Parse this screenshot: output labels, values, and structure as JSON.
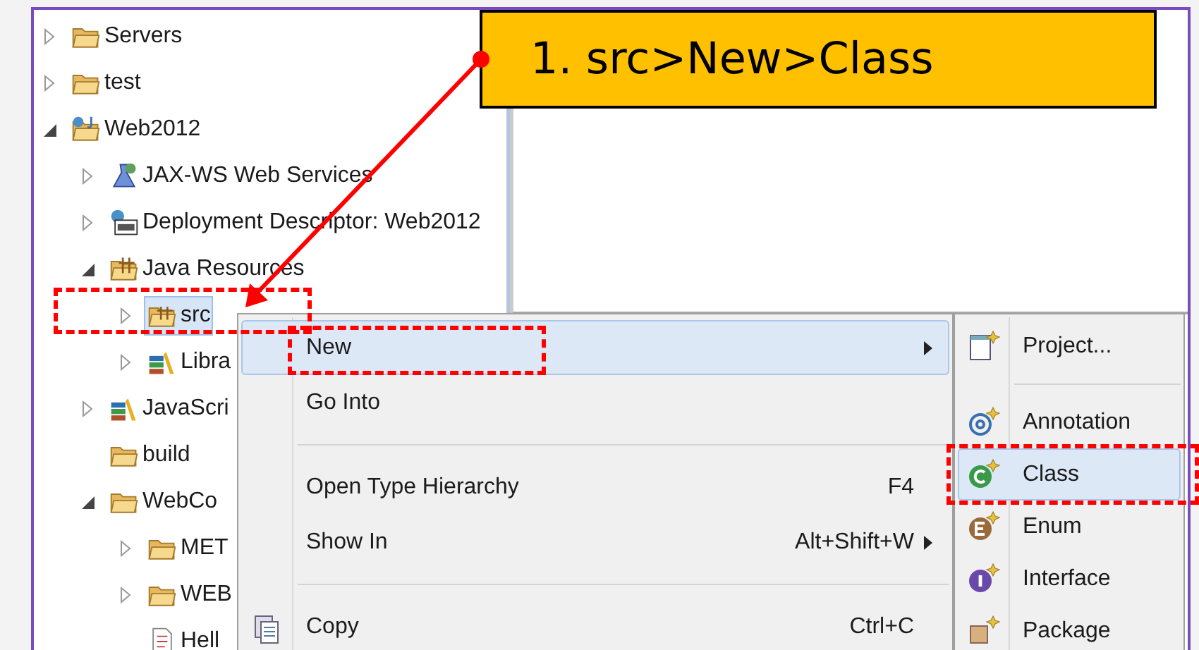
{
  "project_tree": [
    {
      "label": "Servers",
      "kind": "folder",
      "expanded": false,
      "selected": false
    },
    {
      "label": "test",
      "kind": "folder",
      "expanded": false,
      "selected": false
    },
    {
      "label": "Web2012",
      "kind": "project",
      "expanded": true,
      "selected": false,
      "children": [
        {
          "label": "JAX-WS Web Services",
          "kind": "services",
          "expanded": false,
          "selected": false
        },
        {
          "label": "Deployment Descriptor: Web2012",
          "kind": "descriptor",
          "expanded": false,
          "selected": false
        },
        {
          "label": "Java Resources",
          "kind": "resources",
          "expanded": true,
          "selected": false,
          "children": [
            {
              "label": "src",
              "kind": "package",
              "expanded": false,
              "selected": true
            },
            {
              "label": "Libra",
              "kind": "library",
              "expanded": false,
              "selected": false
            }
          ]
        },
        {
          "label": "JavaScri",
          "kind": "library",
          "expanded": false,
          "selected": false
        },
        {
          "label": "build",
          "kind": "folder",
          "selected": false
        },
        {
          "label": "WebCo",
          "kind": "folder",
          "expanded": true,
          "selected": false,
          "children": [
            {
              "label": "MET",
              "kind": "folder",
              "expanded": false,
              "selected": false
            },
            {
              "label": "WEB",
              "kind": "folder",
              "expanded": false,
              "selected": false
            },
            {
              "label": "Hell",
              "kind": "file",
              "selected": false
            }
          ]
        }
      ]
    }
  ],
  "context_menu": [
    {
      "kind": "item",
      "label": "New",
      "selected": true,
      "submenu": true
    },
    {
      "kind": "item",
      "label": "Go Into",
      "selected": false,
      "submenu": false
    },
    {
      "kind": "separator"
    },
    {
      "kind": "item",
      "label": "Open Type Hierarchy",
      "shortcut": "F4",
      "selected": false,
      "submenu": false
    },
    {
      "kind": "item",
      "label": "Show In",
      "shortcut": "Alt+Shift+W",
      "selected": false,
      "submenu": true
    },
    {
      "kind": "separator"
    },
    {
      "kind": "clipboard",
      "label": "Copy",
      "shortcut": "Ctrl+C",
      "selected": false,
      "submenu": false
    }
  ],
  "submenu": [
    {
      "kind": "project",
      "label": "Project...",
      "selected": false
    },
    {
      "kind": "separator"
    },
    {
      "kind": "annotation",
      "label": "Annotation",
      "selected": false
    },
    {
      "kind": "class",
      "label": "Class",
      "selected": true
    },
    {
      "kind": "enum",
      "label": "Enum",
      "selected": false
    },
    {
      "kind": "interface",
      "label": "Interface",
      "selected": false
    },
    {
      "kind": "package",
      "label": "Package",
      "selected": false
    }
  ],
  "callout": {
    "text": "1. src>New>Class"
  }
}
